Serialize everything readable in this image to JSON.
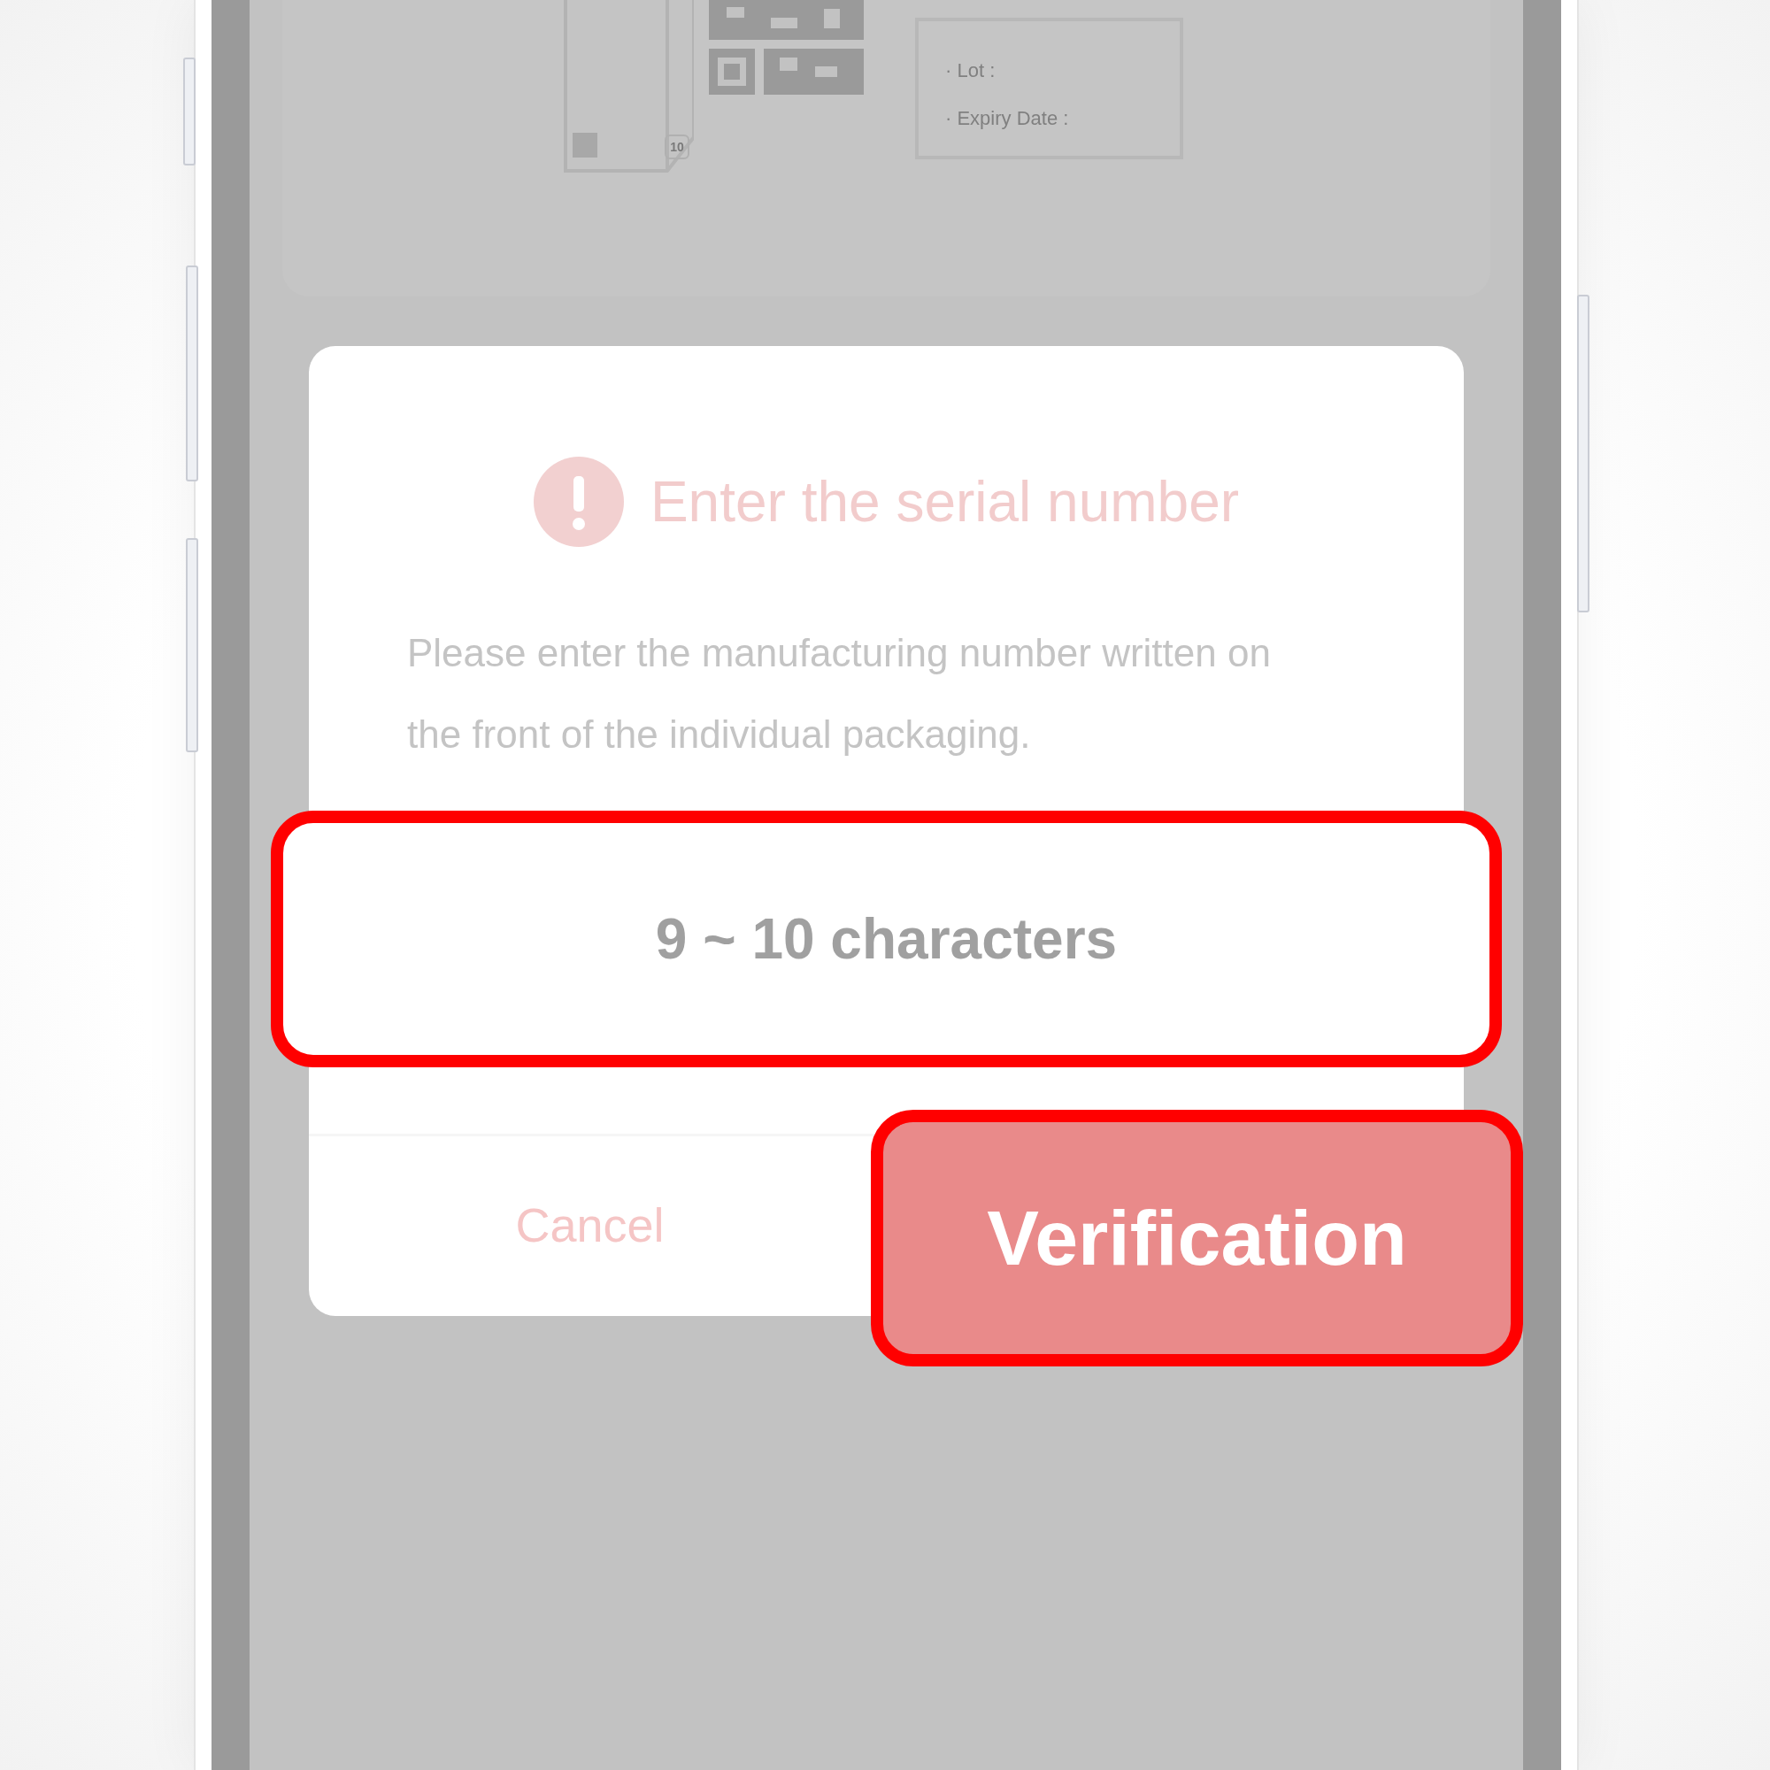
{
  "background": {
    "box_badge": "10",
    "labels": [
      "· Lot :",
      "· Expiry Date :"
    ]
  },
  "dialog": {
    "title": "Enter the serial number",
    "message": "Please enter the manufacturing number written on the front of the individual packaging.",
    "input": {
      "placeholder": "9 ~ 10 characters"
    },
    "buttons": [
      {
        "label": "Cancel",
        "kind": "cancel"
      },
      {
        "label": "Verification",
        "kind": "confirm"
      }
    ]
  }
}
